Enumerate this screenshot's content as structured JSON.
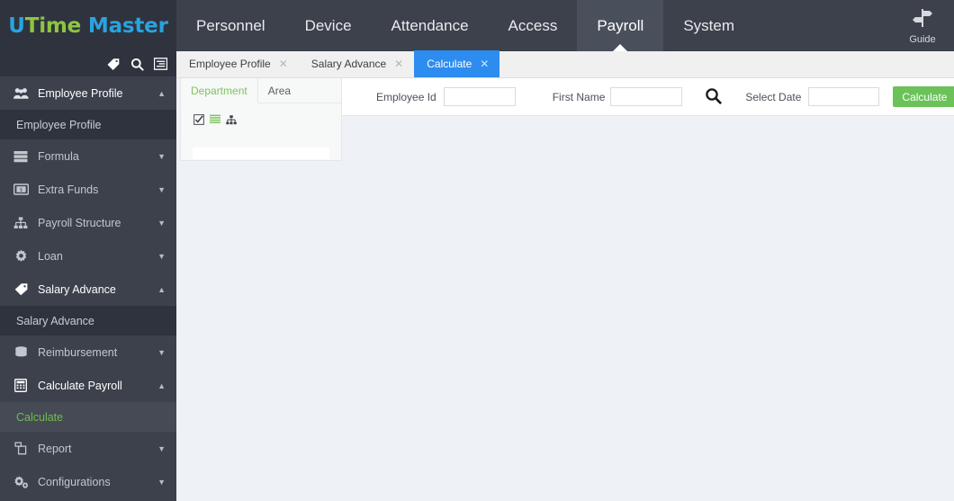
{
  "brand": {
    "part1": "U",
    "part2": "Time",
    "part3": " Master",
    "color_blue": "#29a3e0",
    "color_green": "#8cc63f"
  },
  "header": {
    "nav": [
      {
        "label": "Personnel",
        "active": false
      },
      {
        "label": "Device",
        "active": false
      },
      {
        "label": "Attendance",
        "active": false
      },
      {
        "label": "Access",
        "active": false
      },
      {
        "label": "Payroll",
        "active": true
      },
      {
        "label": "System",
        "active": false
      }
    ],
    "guide_label": "Guide",
    "active_bg": "#4a505b",
    "bg": "#3c414c"
  },
  "sidebar": {
    "toolbar_icons": [
      "tag-icon",
      "search-icon",
      "collapse-menu-icon"
    ],
    "bg": "#3c414c",
    "selected_color": "#6fbe4a",
    "groups": [
      {
        "icon": "people-group-icon",
        "label": "Employee Profile",
        "expanded": true,
        "caret": "up",
        "children": [
          {
            "label": "Employee Profile",
            "selected": false
          }
        ]
      },
      {
        "icon": "server-stack-icon",
        "label": "Formula",
        "expanded": false,
        "caret": "down",
        "children": []
      },
      {
        "icon": "banknote-icon",
        "label": "Extra Funds",
        "expanded": false,
        "caret": "down",
        "children": []
      },
      {
        "icon": "sitemap-icon",
        "label": "Payroll Structure",
        "expanded": false,
        "caret": "down",
        "children": []
      },
      {
        "icon": "gear-icon",
        "label": "Loan",
        "expanded": false,
        "caret": "down",
        "children": []
      },
      {
        "icon": "tag-icon",
        "label": "Salary Advance",
        "expanded": true,
        "caret": "up",
        "children": [
          {
            "label": "Salary Advance",
            "selected": false
          }
        ]
      },
      {
        "icon": "database-icon",
        "label": "Reimbursement",
        "expanded": false,
        "caret": "down",
        "children": []
      },
      {
        "icon": "calculator-icon",
        "label": "Calculate Payroll",
        "expanded": true,
        "caret": "up",
        "children": [
          {
            "label": "Calculate",
            "selected": true
          }
        ]
      },
      {
        "icon": "copy-files-icon",
        "label": "Report",
        "expanded": false,
        "caret": "down",
        "children": []
      },
      {
        "icon": "gears-icon",
        "label": "Configurations",
        "expanded": false,
        "caret": "down",
        "children": []
      }
    ]
  },
  "tabbar": {
    "active_bg": "#2d8cf0",
    "tabs": [
      {
        "label": "Employee Profile",
        "active": false,
        "close": "✕"
      },
      {
        "label": "Salary Advance",
        "active": false,
        "close": "✕"
      },
      {
        "label": "Calculate",
        "active": true,
        "close": "✕"
      }
    ]
  },
  "tree_panel": {
    "tabs": [
      {
        "label": "Department",
        "active": true
      },
      {
        "label": "Area",
        "active": false
      }
    ],
    "icons": [
      "select-all-checkbox-icon",
      "list-view-icon",
      "tree-view-icon"
    ],
    "search_value": "",
    "active_color": "#7ec45c"
  },
  "filter_bar": {
    "employee_id": {
      "label": "Employee Id",
      "value": "",
      "placeholder": ""
    },
    "first_name": {
      "label": "First Name",
      "value": "",
      "placeholder": ""
    },
    "search_icon": "search-icon",
    "select_date": {
      "label": "Select Date",
      "value": "",
      "placeholder": ""
    },
    "calculate_button": {
      "label": "Calculate",
      "color": "#6ac259"
    }
  },
  "content": {
    "background": "#eef1f5"
  }
}
